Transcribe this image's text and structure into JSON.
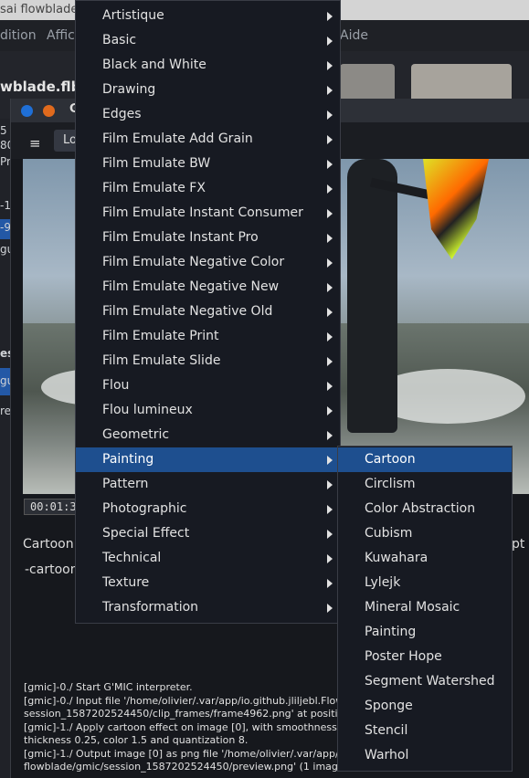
{
  "app": {
    "title_fragment": "sai flowblade",
    "menubar": [
      "dition",
      "Affich",
      "Aide"
    ],
    "project_name": "wblade.flb",
    "left_strip_text": [
      "5",
      "80",
      "Pr",
      "-1",
      "-9",
      "gu",
      "es",
      "gu",
      "re"
    ]
  },
  "gmic": {
    "title_fragment": "G",
    "toolbar_button": "Lo",
    "hamburger": "≡",
    "timecode": "00:01:3",
    "filter_name": "Cartoon",
    "filter_command": "-cartoon",
    "right_param_fragment": "pt",
    "log": [
      "[gmic]-0./ Start G'MIC interpreter.",
      "[gmic]-0./ Input file '/home/olivier/.var/app/io.github.jliljebl.Flow",
      "session_1587202524450/clip_frames/frame4962.png' at positi",
      "[gmic]-1./ Apply cartoon effect on image [0], with smoothness 3",
      "thickness 0.25, color 1.5 and quantization 8.",
      "[gmic]-1./ Output image [0] as png file '/home/olivier/.var/app/io",
      "flowblade/gmic/session_1587202524450/preview.png' (1 imag"
    ]
  },
  "menu": {
    "items": [
      {
        "label": "Artistique",
        "has_submenu": true
      },
      {
        "label": "Basic",
        "has_submenu": true
      },
      {
        "label": "Black and White",
        "has_submenu": true
      },
      {
        "label": "Drawing",
        "has_submenu": true
      },
      {
        "label": "Edges",
        "has_submenu": true
      },
      {
        "label": "Film Emulate Add Grain",
        "has_submenu": true
      },
      {
        "label": "Film Emulate BW",
        "has_submenu": true
      },
      {
        "label": "Film Emulate FX",
        "has_submenu": true
      },
      {
        "label": "Film Emulate Instant Consumer",
        "has_submenu": true
      },
      {
        "label": "Film Emulate Instant Pro",
        "has_submenu": true
      },
      {
        "label": "Film Emulate Negative Color",
        "has_submenu": true
      },
      {
        "label": "Film Emulate Negative New",
        "has_submenu": true
      },
      {
        "label": "Film Emulate Negative Old",
        "has_submenu": true
      },
      {
        "label": "Film Emulate Print",
        "has_submenu": true
      },
      {
        "label": "Film Emulate Slide",
        "has_submenu": true
      },
      {
        "label": "Flou",
        "has_submenu": true
      },
      {
        "label": "Flou lumineux",
        "has_submenu": true
      },
      {
        "label": "Geometric",
        "has_submenu": true
      },
      {
        "label": "Painting",
        "has_submenu": true,
        "active": true
      },
      {
        "label": "Pattern",
        "has_submenu": true
      },
      {
        "label": "Photographic",
        "has_submenu": true
      },
      {
        "label": "Special Effect",
        "has_submenu": true
      },
      {
        "label": "Technical",
        "has_submenu": true
      },
      {
        "label": "Texture",
        "has_submenu": true
      },
      {
        "label": "Transformation",
        "has_submenu": true
      }
    ]
  },
  "submenu": {
    "items": [
      {
        "label": "Cartoon",
        "active": true
      },
      {
        "label": "Circlism"
      },
      {
        "label": "Color Abstraction"
      },
      {
        "label": "Cubism"
      },
      {
        "label": "Kuwahara"
      },
      {
        "label": "Lylejk"
      },
      {
        "label": "Mineral Mosaic"
      },
      {
        "label": "Painting"
      },
      {
        "label": "Poster Hope"
      },
      {
        "label": "Segment Watershed"
      },
      {
        "label": "Sponge"
      },
      {
        "label": "Stencil"
      },
      {
        "label": "Warhol"
      }
    ]
  },
  "colors": {
    "highlight": "#1e4f8f",
    "menu_bg": "#171a22",
    "close_dot": "#1f6fd6",
    "min_dot": "#e06a1d"
  }
}
